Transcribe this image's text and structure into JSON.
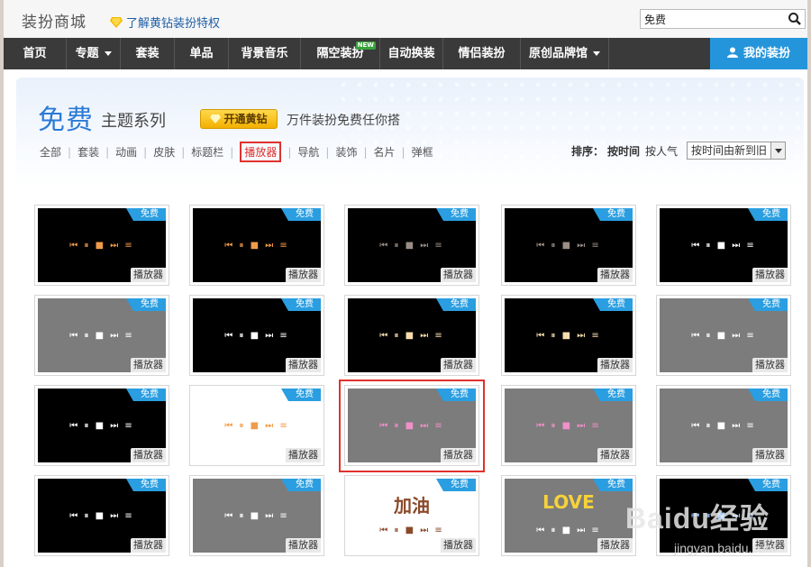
{
  "header": {
    "logo": "装扮商城",
    "vip_link": "了解黄钻装扮特权",
    "search_value": "免费"
  },
  "nav": {
    "items": [
      {
        "label": "首页",
        "dropdown": false,
        "new": false
      },
      {
        "label": "专题",
        "dropdown": true,
        "new": false
      },
      {
        "label": "套装",
        "dropdown": false,
        "new": false
      },
      {
        "label": "单品",
        "dropdown": false,
        "new": false
      },
      {
        "label": "背景音乐",
        "dropdown": false,
        "new": false
      },
      {
        "label": "隔空装扮",
        "dropdown": false,
        "new": true
      },
      {
        "label": "自动换装",
        "dropdown": false,
        "new": false
      },
      {
        "label": "情侣装扮",
        "dropdown": false,
        "new": false
      },
      {
        "label": "原创品牌馆",
        "dropdown": true,
        "new": false
      }
    ],
    "new_badge": "NEW",
    "mine_label": "我的装扮"
  },
  "hero": {
    "title": "免费",
    "subtitle": "主题系列",
    "vip_button": "开通黄钻",
    "slogan": "万件装扮免费任你搭"
  },
  "filters": [
    "全部",
    "套装",
    "动画",
    "皮肤",
    "标题栏",
    "播放器",
    "导航",
    "装饰",
    "名片",
    "弹框"
  ],
  "active_filter": "播放器",
  "sort": {
    "label": "排序：",
    "options": [
      "按时间",
      "按人气"
    ],
    "current": "按时间",
    "select_value": "按时间由新到旧"
  },
  "card_ribbon": "免费",
  "card_tag": "播放器",
  "cards": [
    {
      "style": "dark",
      "ctrl": "orange"
    },
    {
      "style": "dark",
      "ctrl": "orange"
    },
    {
      "style": "dark",
      "ctrl": "grey"
    },
    {
      "style": "dark",
      "ctrl": "grey"
    },
    {
      "style": "dark",
      "ctrl": "white"
    },
    {
      "style": "grey",
      "ctrl": "white"
    },
    {
      "style": "dark",
      "ctrl": "white"
    },
    {
      "style": "dark",
      "ctrl": "cream"
    },
    {
      "style": "dark",
      "ctrl": "cream"
    },
    {
      "style": "grey",
      "ctrl": "white"
    },
    {
      "style": "dark",
      "ctrl": "white"
    },
    {
      "style": "white",
      "ctrl": "orange"
    },
    {
      "style": "grey",
      "ctrl": "pink"
    },
    {
      "style": "grey",
      "ctrl": "pink"
    },
    {
      "style": "grey",
      "ctrl": "white"
    },
    {
      "style": "dark",
      "ctrl": "white"
    },
    {
      "style": "grey",
      "ctrl": "white"
    },
    {
      "style": "white",
      "ctrl": "brown",
      "text": "加油"
    },
    {
      "style": "grey",
      "ctrl": "white",
      "text": "LOVE"
    },
    {
      "style": "dark",
      "ctrl": "blue"
    }
  ],
  "watermark": {
    "brand": "Baidu经验",
    "url": "jingyan.baidu.com"
  },
  "colors": {
    "accent": "#2495db",
    "nav_bg": "#3a3a3a",
    "ribbon": "#2a9ee0",
    "highlight": "#e0312e",
    "vip": "#f2b000"
  }
}
